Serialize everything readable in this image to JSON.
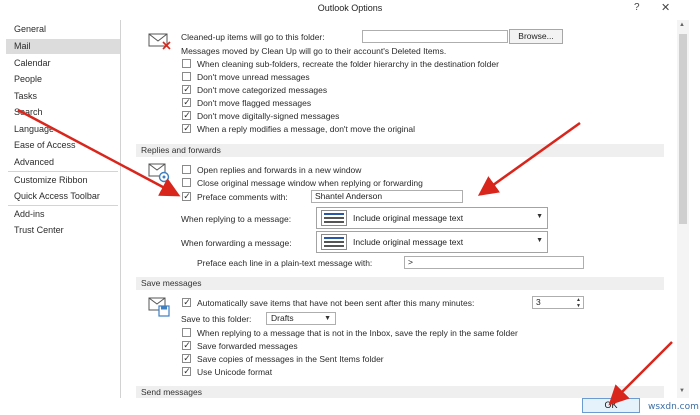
{
  "window": {
    "title": "Outlook Options",
    "help": "?",
    "close": "✕"
  },
  "sidebar": {
    "items": [
      {
        "label": "General"
      },
      {
        "label": "Mail"
      },
      {
        "label": "Calendar"
      },
      {
        "label": "People"
      },
      {
        "label": "Tasks"
      },
      {
        "label": "Search"
      },
      {
        "label": "Language"
      },
      {
        "label": "Ease of Access"
      },
      {
        "label": "Advanced"
      },
      {
        "label": "Customize Ribbon"
      },
      {
        "label": "Quick Access Toolbar"
      },
      {
        "label": "Add-ins"
      },
      {
        "label": "Trust Center"
      }
    ],
    "selected": "Mail"
  },
  "cleanup": {
    "folder_label": "Cleaned-up items will go to this folder:",
    "folder_value": "",
    "browse_button": "Browse...",
    "info": "Messages moved by Clean Up will go to their account's Deleted Items.",
    "options": [
      {
        "label": "When cleaning sub-folders, recreate the folder hierarchy in the destination folder",
        "checked": false
      },
      {
        "label": "Don't move unread messages",
        "checked": false
      },
      {
        "label": "Don't move categorized messages",
        "checked": true
      },
      {
        "label": "Don't move flagged messages",
        "checked": true
      },
      {
        "label": "Don't move digitally-signed messages",
        "checked": true
      },
      {
        "label": "When a reply modifies a message, don't move the original",
        "checked": true
      }
    ]
  },
  "replies": {
    "heading": "Replies and forwards",
    "open_new_window": {
      "label": "Open replies and forwards in a new window",
      "checked": false
    },
    "close_original": {
      "label": "Close original message window when replying or forwarding",
      "checked": false
    },
    "preface_comments": {
      "label": "Preface comments with:",
      "checked": true,
      "value": "Shantel Anderson"
    },
    "replying_label": "When replying to a message:",
    "replying_value": "Include original message text",
    "forwarding_label": "When forwarding a message:",
    "forwarding_value": "Include original message text",
    "preface_line_label": "Preface each line in a plain-text message with:",
    "preface_line_value": ">"
  },
  "save_messages": {
    "heading": "Save messages",
    "autosave": {
      "label": "Automatically save items that have not been sent after this many minutes:",
      "checked": true,
      "value": "3"
    },
    "save_folder_label": "Save to this folder:",
    "save_folder_value": "Drafts",
    "options": [
      {
        "label": "When replying to a message that is not in the Inbox, save the reply in the same folder",
        "checked": false
      },
      {
        "label": "Save forwarded messages",
        "checked": true
      },
      {
        "label": "Save copies of messages in the Sent Items folder",
        "checked": true
      },
      {
        "label": "Use Unicode format",
        "checked": true
      }
    ]
  },
  "send_messages": {
    "heading": "Send messages"
  },
  "footer": {
    "ok_button": "OK",
    "watermark": "wsxdn.com"
  },
  "colors": {
    "arrow": "#d9261c",
    "selected_nav": "#dcdcdc",
    "section_bg": "#efefef"
  },
  "icons": [
    "cleanup-trash-icon",
    "reply-gear-icon",
    "save-disk-icon",
    "checkmark-icon",
    "chevron-down-icon"
  ]
}
